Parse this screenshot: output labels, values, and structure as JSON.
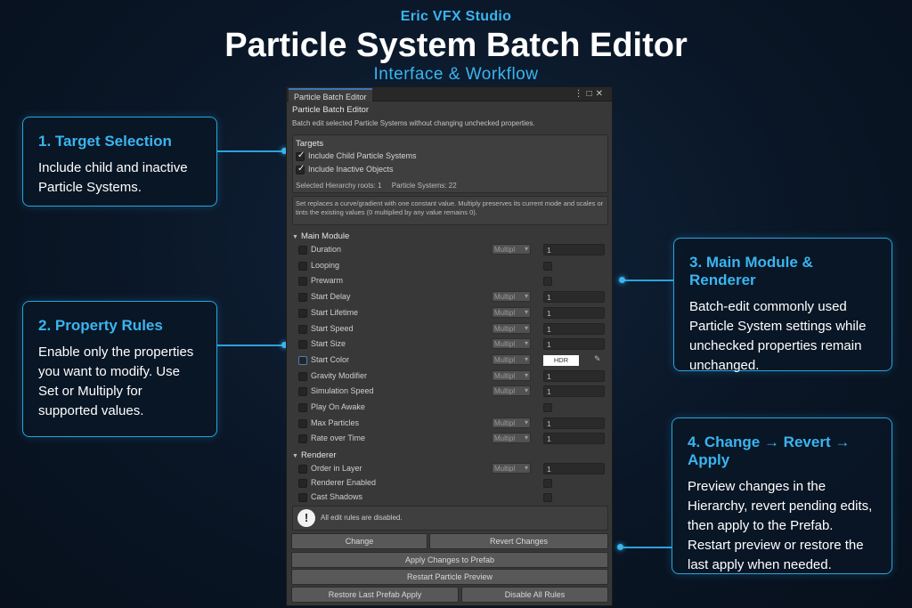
{
  "header": {
    "studio": "Eric VFX Studio",
    "title": "Particle System Batch Editor",
    "subtitle": "Interface & Workflow"
  },
  "callouts": [
    {
      "title": "1. Target Selection",
      "body": "Include child and inactive Particle Systems."
    },
    {
      "title": "2. Property Rules",
      "body": "Enable only the properties you want to modify. Use Set or Multiply for supported values."
    },
    {
      "title": "3. Main Module & Renderer",
      "body": "Batch-edit commonly used Particle System settings while unchecked properties remain unchanged."
    },
    {
      "title": "4. Change → Revert → Apply",
      "body": "Preview changes in the Hierarchy, revert pending edits, then apply to the Prefab. Restart preview or restore the last apply when needed."
    }
  ],
  "window": {
    "tab_label": "Particle Batch Editor",
    "editor_title": "Particle Batch Editor",
    "description": "Batch edit selected Particle Systems without changing unchecked properties.",
    "targets": {
      "label": "Targets",
      "include_children": "Include Child Particle Systems",
      "include_inactive": "Include Inactive Objects",
      "include_children_checked": true,
      "include_inactive_checked": true,
      "roots": "Selected Hierarchy roots: 1",
      "systems": "Particle Systems: 22"
    },
    "help_text": "Set replaces a curve/gradient with one constant value. Multiply preserves its current mode and scales or tints the existing values (0 multiplied by any value remains 0).",
    "main_module": {
      "label": "Main Module",
      "rows": [
        {
          "name": "Duration",
          "mode": "Multipl",
          "value": "1"
        },
        {
          "name": "Looping"
        },
        {
          "name": "Prewarm"
        },
        {
          "name": "Start Delay",
          "mode": "Multipl",
          "value": "1"
        },
        {
          "name": "Start Lifetime",
          "mode": "Multipl",
          "value": "1"
        },
        {
          "name": "Start Speed",
          "mode": "Multipl",
          "value": "1"
        },
        {
          "name": "Start Size",
          "mode": "Multipl",
          "value": "1"
        },
        {
          "name": "Start Color",
          "mode": "Multipl",
          "value": "HDR"
        },
        {
          "name": "Gravity Modifier",
          "mode": "Multipl",
          "value": "1"
        },
        {
          "name": "Simulation Speed",
          "mode": "Multipl",
          "value": "1"
        },
        {
          "name": "Play On Awake"
        },
        {
          "name": "Max Particles",
          "mode": "Multipl",
          "value": "1"
        },
        {
          "name": "Rate over Time",
          "mode": "Multipl",
          "value": "1"
        }
      ]
    },
    "renderer": {
      "label": "Renderer",
      "rows": [
        {
          "name": "Order in Layer",
          "mode": "Multipl",
          "value": "1"
        },
        {
          "name": "Renderer Enabled"
        },
        {
          "name": "Cast Shadows"
        }
      ]
    },
    "warning": "All edit rules are disabled.",
    "buttons": {
      "change": "Change",
      "revert": "Revert Changes",
      "apply": "Apply Changes to Prefab",
      "restart": "Restart Particle Preview",
      "restore": "Restore Last Prefab Apply",
      "disable": "Disable All Rules"
    }
  }
}
